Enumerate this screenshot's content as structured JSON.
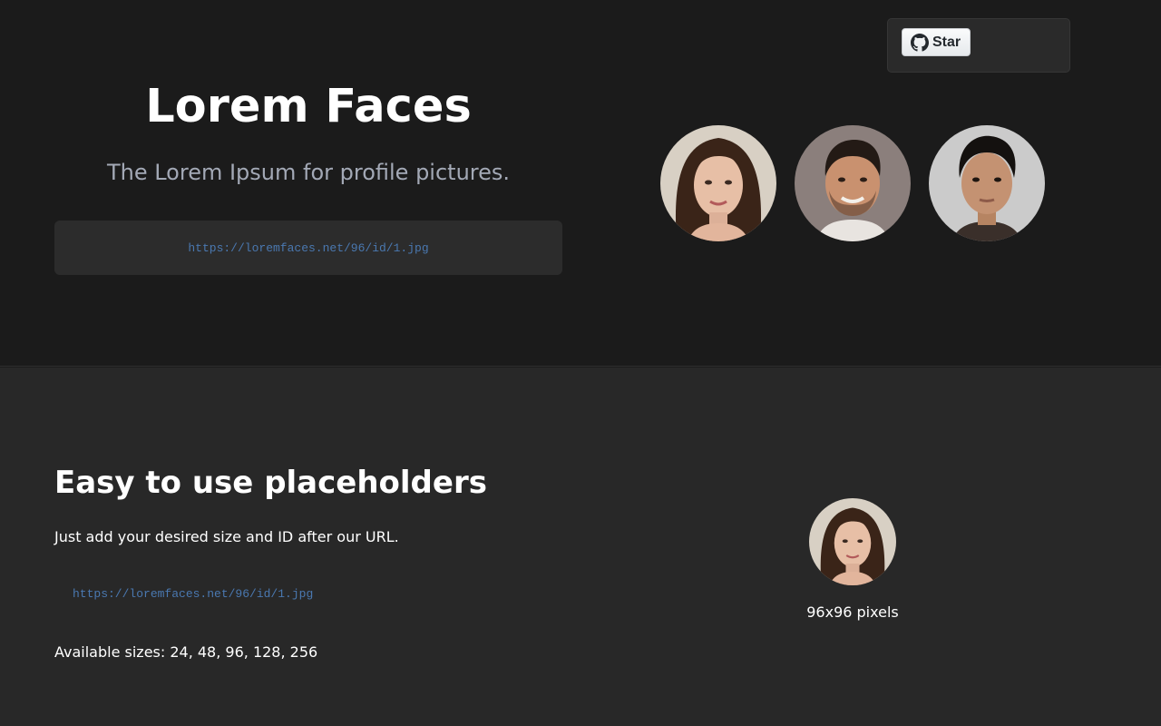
{
  "github": {
    "star_label": "Star",
    "icon": "github-icon"
  },
  "hero": {
    "title": "Lorem Faces",
    "tagline": "The Lorem Ipsum for profile pictures.",
    "url": "https://loremfaces.net/96/id/1.jpg",
    "avatars": [
      "face-1",
      "face-2",
      "face-3"
    ]
  },
  "usage": {
    "heading": "Easy to use placeholders",
    "description": "Just add your desired size and ID after our URL.",
    "url": "https://loremfaces.net/96/id/1.jpg",
    "sizes": "Available sizes: 24, 48, 96, 128, 256",
    "preview_caption": "96x96 pixels"
  },
  "colors": {
    "hero_bg": "#1b1b1b",
    "section_bg": "#282828",
    "url_color": "#4a78b0",
    "tagline_color": "#a3a9b6"
  }
}
